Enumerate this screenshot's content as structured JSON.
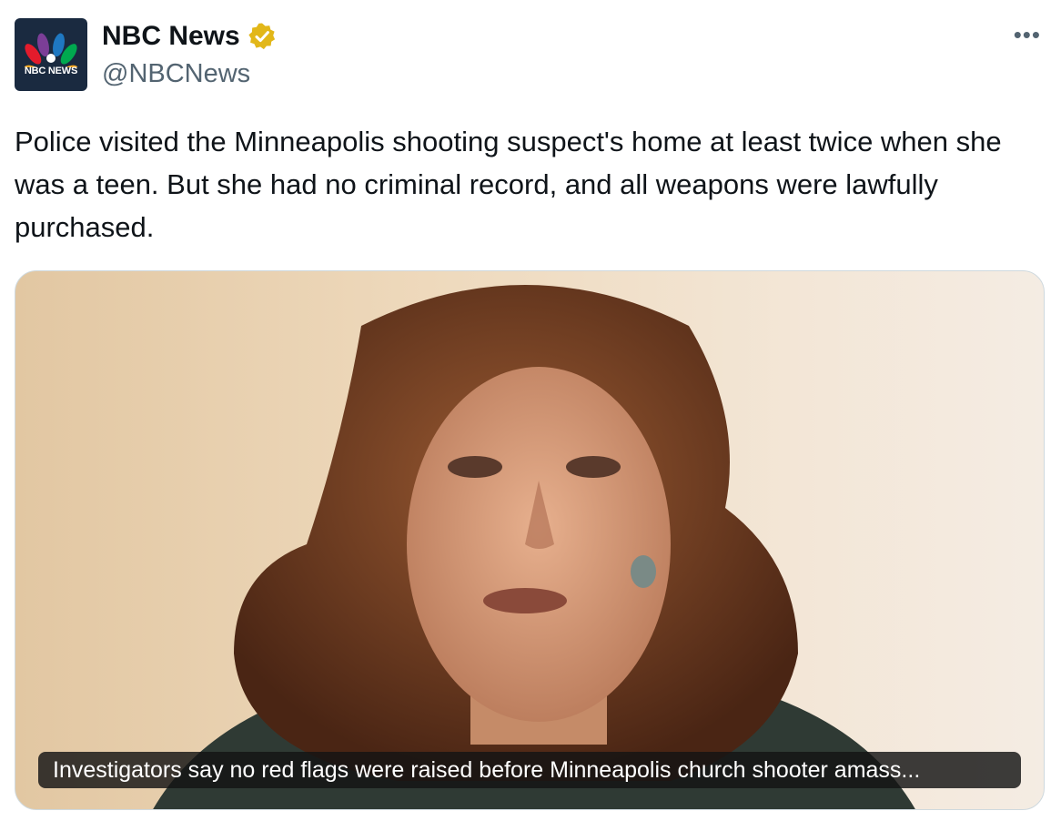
{
  "account": {
    "name": "NBC News",
    "handle": "@NBCNews",
    "logo_text": "NBC NEWS",
    "verified": true,
    "verified_color": "#e2b719",
    "avatar_icon": "nbc-peacock-icon"
  },
  "tweet": {
    "text": "Police visited the Minneapolis shooting suspect's home at least twice when she was a teen. But she had no criminal record, and all weapons were lawfully purchased.",
    "more_label": "•••"
  },
  "media": {
    "type": "video-thumbnail",
    "caption": "Investigators say no red flags were raised before Minneapolis church shooter amass..."
  }
}
